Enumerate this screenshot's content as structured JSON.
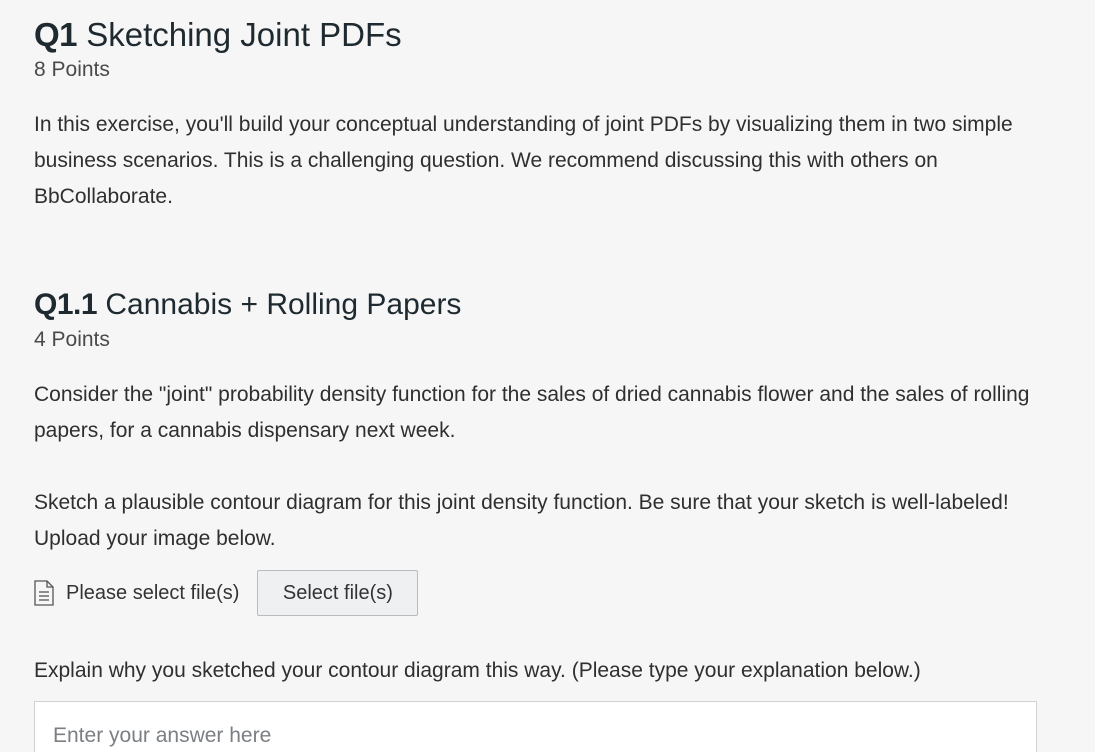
{
  "q1": {
    "number": "Q1",
    "title": "Sketching Joint PDFs",
    "points": "8 Points",
    "description": "In this exercise, you'll build your conceptual understanding of joint PDFs by visualizing them in two simple business scenarios.  This is a challenging question.  We recommend discussing this with others on BbCollaborate."
  },
  "q11": {
    "number": "Q1.1",
    "title": "Cannabis + Rolling Papers",
    "points": "4 Points",
    "paragraph1": "Consider the \"joint\" probability density function for the sales of dried cannabis flower and the sales of rolling papers, for a cannabis dispensary next week.",
    "paragraph2": "Sketch a plausible contour diagram for this joint density function.  Be sure that your sketch is well-labeled!  Upload your image below.",
    "upload": {
      "icon": "file-document-icon",
      "label": "Please select file(s)",
      "button": "Select file(s)"
    },
    "explain": "Explain why you sketched your contour diagram this way.  (Please type your explanation below.)",
    "answer_placeholder": "Enter your answer here"
  }
}
